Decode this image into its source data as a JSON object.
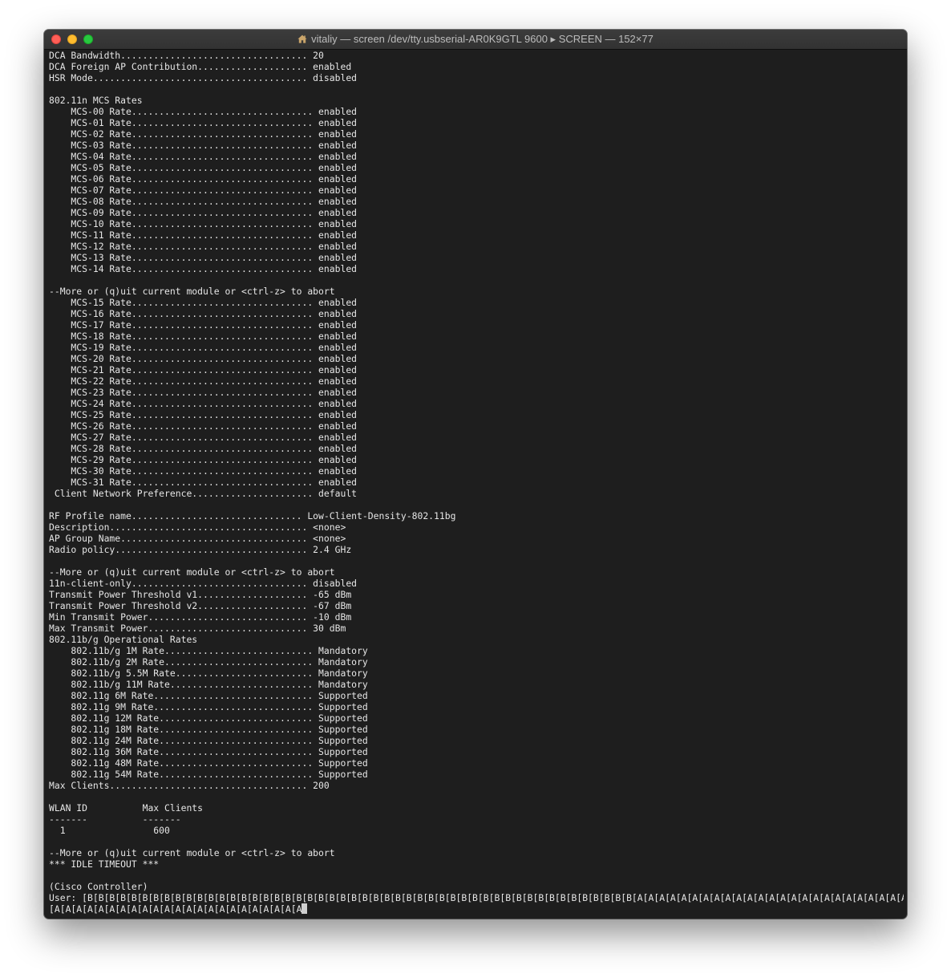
{
  "window": {
    "title": "vitaliy — screen /dev/tty.usbserial-AR0K9GTL 9600 ▸ SCREEN — 152×77",
    "home_icon": "home-icon"
  },
  "terminal": {
    "lines": [
      "DCA Bandwidth.................................. 20",
      "DCA Foreign AP Contribution.................... enabled",
      "HSR Mode....................................... disabled",
      "",
      "802.11n MCS Rates",
      "    MCS-00 Rate................................. enabled",
      "    MCS-01 Rate................................. enabled",
      "    MCS-02 Rate................................. enabled",
      "    MCS-03 Rate................................. enabled",
      "    MCS-04 Rate................................. enabled",
      "    MCS-05 Rate................................. enabled",
      "    MCS-06 Rate................................. enabled",
      "    MCS-07 Rate................................. enabled",
      "    MCS-08 Rate................................. enabled",
      "    MCS-09 Rate................................. enabled",
      "    MCS-10 Rate................................. enabled",
      "    MCS-11 Rate................................. enabled",
      "    MCS-12 Rate................................. enabled",
      "    MCS-13 Rate................................. enabled",
      "    MCS-14 Rate................................. enabled",
      "",
      "--More or (q)uit current module or <ctrl-z> to abort",
      "    MCS-15 Rate................................. enabled",
      "    MCS-16 Rate................................. enabled",
      "    MCS-17 Rate................................. enabled",
      "    MCS-18 Rate................................. enabled",
      "    MCS-19 Rate................................. enabled",
      "    MCS-20 Rate................................. enabled",
      "    MCS-21 Rate................................. enabled",
      "    MCS-22 Rate................................. enabled",
      "    MCS-23 Rate................................. enabled",
      "    MCS-24 Rate................................. enabled",
      "    MCS-25 Rate................................. enabled",
      "    MCS-26 Rate................................. enabled",
      "    MCS-27 Rate................................. enabled",
      "    MCS-28 Rate................................. enabled",
      "    MCS-29 Rate................................. enabled",
      "    MCS-30 Rate................................. enabled",
      "    MCS-31 Rate................................. enabled",
      " Client Network Preference...................... default",
      "",
      "RF Profile name............................... Low-Client-Density-802.11bg",
      "Description.................................... <none>",
      "AP Group Name.................................. <none>",
      "Radio policy................................... 2.4 GHz",
      "",
      "--More or (q)uit current module or <ctrl-z> to abort",
      "11n-client-only................................ disabled",
      "Transmit Power Threshold v1.................... -65 dBm",
      "Transmit Power Threshold v2.................... -67 dBm",
      "Min Transmit Power............................. -10 dBm",
      "Max Transmit Power............................. 30 dBm",
      "802.11b/g Operational Rates",
      "    802.11b/g 1M Rate........................... Mandatory",
      "    802.11b/g 2M Rate........................... Mandatory",
      "    802.11b/g 5.5M Rate......................... Mandatory",
      "    802.11b/g 11M Rate.......................... Mandatory",
      "    802.11g 6M Rate............................. Supported",
      "    802.11g 9M Rate............................. Supported",
      "    802.11g 12M Rate............................ Supported",
      "    802.11g 18M Rate............................ Supported",
      "    802.11g 24M Rate............................ Supported",
      "    802.11g 36M Rate............................ Supported",
      "    802.11g 48M Rate............................ Supported",
      "    802.11g 54M Rate............................ Supported",
      "Max Clients.................................... 200",
      "",
      "WLAN ID          Max Clients",
      "-------          -------",
      "  1                600",
      "",
      "--More or (q)uit current module or <ctrl-z> to abort",
      "*** IDLE TIMEOUT ***",
      "",
      "(Cisco Controller)",
      "User: [B[B[B[B[B[B[B[B[B[B[B[B[B[B[B[B[B[B[B[B[B[B[B[B[B[B[B[B[B[B[B[B[B[B[B[B[B[B[B[B[B[B[B[B[B[B[B[B[B[B[A[A[A[A[A[A[A[A[A[A[A[A[A[A[A[A[A[A[A[A[A[A[A[A[A[A[A[A[A[A",
      "[A[A[A[A[A[A[A[A[A[A[A[A[A[A[A[A[A[A[A[A[A[A[A"
    ]
  }
}
